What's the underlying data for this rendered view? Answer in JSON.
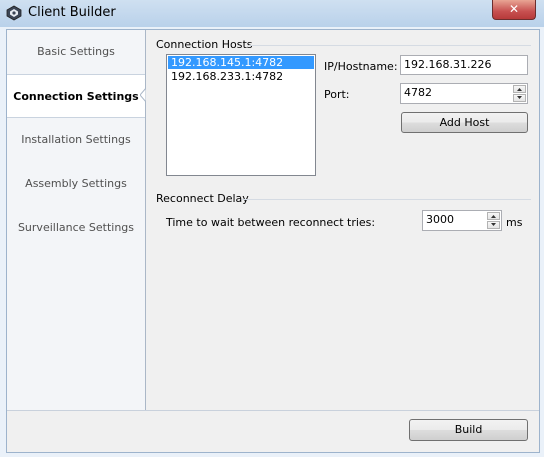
{
  "window": {
    "title": "Client Builder",
    "close_label": "✕"
  },
  "sidebar": {
    "items": [
      {
        "label": "Basic Settings",
        "active": false
      },
      {
        "label": "Connection Settings",
        "active": true
      },
      {
        "label": "Installation Settings",
        "active": false
      },
      {
        "label": "Assembly Settings",
        "active": false
      },
      {
        "label": "Surveillance Settings",
        "active": false
      }
    ]
  },
  "connection_hosts": {
    "title": "Connection Hosts",
    "hosts": [
      "192.168.145.1:4782",
      "192.168.233.1:4782"
    ],
    "selected_index": 0,
    "ip_label": "IP/Hostname:",
    "ip_value": "192.168.31.226",
    "port_label": "Port:",
    "port_value": "4782",
    "add_button": "Add Host"
  },
  "reconnect_delay": {
    "title": "Reconnect Delay",
    "label": "Time to wait between reconnect tries:",
    "value": "3000",
    "unit": "ms"
  },
  "footer": {
    "build_button": "Build"
  }
}
